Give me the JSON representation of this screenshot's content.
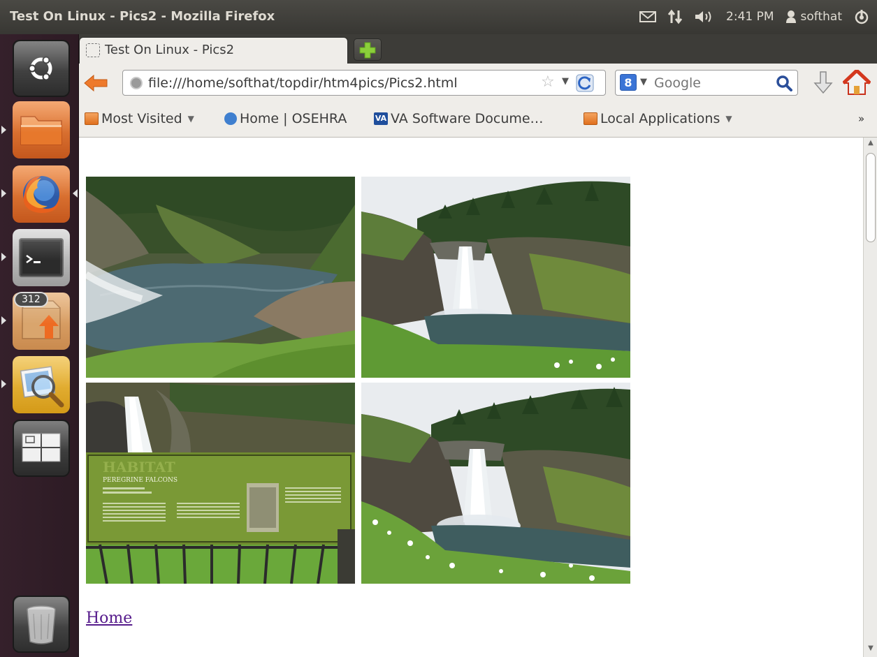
{
  "top_panel": {
    "window_title": "Test On Linux - Pics2 - Mozilla Firefox",
    "clock": "2:41 PM",
    "user": "softhat",
    "icons": [
      "mail-icon",
      "network-icon",
      "volume-icon",
      "user-icon",
      "power-icon"
    ]
  },
  "launcher": {
    "items": [
      {
        "name": "dash",
        "icon": "ubuntu-logo-icon"
      },
      {
        "name": "files",
        "icon": "folder-icon"
      },
      {
        "name": "firefox",
        "icon": "firefox-icon"
      },
      {
        "name": "terminal",
        "icon": "terminal-icon"
      },
      {
        "name": "software-updater",
        "icon": "update-icon",
        "badge": "312"
      },
      {
        "name": "image-viewer",
        "icon": "image-viewer-icon"
      },
      {
        "name": "workspaces",
        "icon": "workspace-switcher-icon"
      },
      {
        "name": "trash",
        "icon": "trash-icon"
      }
    ]
  },
  "browser": {
    "tab_title": "Test On Linux - Pics2",
    "url": "file:///home/softhat/topdir/htm4pics/Pics2.html",
    "search_placeholder": "Google",
    "bookmarks": [
      {
        "label": "Most Visited",
        "dropdown": true
      },
      {
        "label": "Home | OSEHRA",
        "dropdown": false
      },
      {
        "label": "VA Software Docume…",
        "dropdown": false
      },
      {
        "label": "Local Applications",
        "dropdown": true
      }
    ],
    "bookmarks_overflow": "»",
    "colors": {
      "accent_orange": "#e66a1c",
      "visited_link": "#551a8b"
    }
  },
  "page": {
    "photos": [
      {
        "subject": "river-pool-photo"
      },
      {
        "subject": "waterfall-photo"
      },
      {
        "subject": "habitat-sign-photo",
        "sign_heading": "HABITAT",
        "sign_subheading": "PEREGRINE FALCONS"
      },
      {
        "subject": "waterfall-photo-2"
      }
    ],
    "home_link": "Home"
  }
}
